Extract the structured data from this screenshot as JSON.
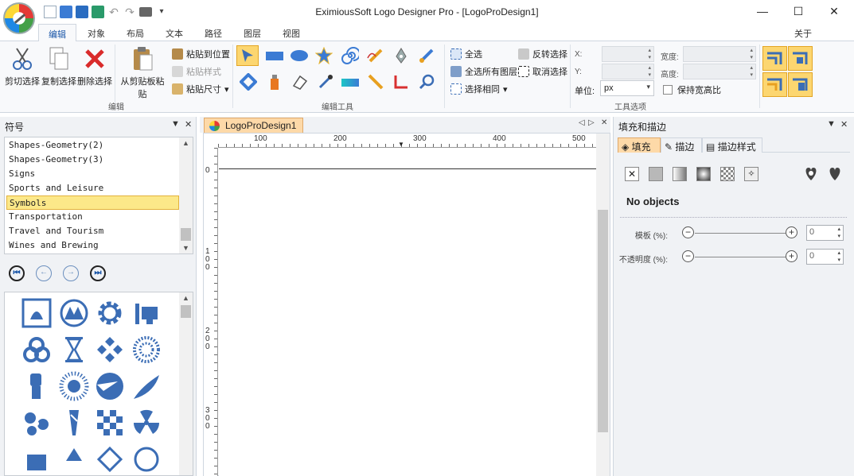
{
  "window": {
    "title": "EximiousSoft Logo Designer Pro - [LogoProDesign1]",
    "minimize": "—",
    "maximize": "☐",
    "close": "✕"
  },
  "ribbon_tabs": [
    "编辑",
    "对象",
    "布局",
    "文本",
    "路径",
    "图层",
    "视图"
  ],
  "about_label": "关于",
  "edit_group": {
    "label": "编辑",
    "cut": "剪切选择",
    "copy": "复制选择",
    "delete": "删除选择",
    "paste": "从剪贴板粘贴",
    "paste_in_place": "粘贴到位置",
    "paste_style": "粘贴样式",
    "paste_size": "粘贴尺寸"
  },
  "edit_tools_group": {
    "label": "编辑工具",
    "select_all": "全选",
    "invert_selection": "反转选择",
    "select_all_layers": "全选所有图层",
    "deselect": "取消选择",
    "select_same": "选择相同"
  },
  "tool_options_group": {
    "label": "工具选项",
    "x_label": "X:",
    "y_label": "Y:",
    "width_label": "宽度:",
    "height_label": "高度:",
    "unit_label": "单位:",
    "unit_value": "px",
    "keep_ratio": "保持宽高比"
  },
  "symbols_panel": {
    "title": "符号",
    "categories": [
      "Shapes-Geometry(2)",
      "Shapes-Geometry(3)",
      "Signs",
      "Sports and Leisure",
      "Symbols",
      "Transportation",
      "Travel and Tourism",
      "Wines and Brewing"
    ],
    "selected_category": "Symbols"
  },
  "document": {
    "tab_title": "LogoProDesign1",
    "h_ruler": [
      "100",
      "200",
      "300",
      "400",
      "500"
    ],
    "v_ruler": [
      "0",
      "100",
      "200",
      "300"
    ]
  },
  "fill_stroke_panel": {
    "title": "填充和描边",
    "tabs": [
      "填充",
      "描边",
      "描边样式"
    ],
    "empty_message": "No objects",
    "template_label": "模板 (%):",
    "template_value": "0",
    "opacity_label": "不透明度 (%):",
    "opacity_value": "0"
  },
  "colors": {
    "accent": "#fcd670",
    "tab_highlight": "#fdd9a8",
    "icon_blue": "#3b6db5"
  }
}
